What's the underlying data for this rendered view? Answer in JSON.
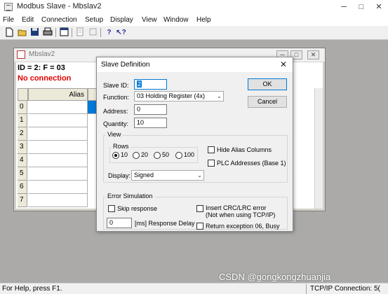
{
  "app": {
    "title": "Modbus Slave - Mbslav2",
    "controls": {
      "minimize": "─",
      "maximize": "□",
      "close": "✕"
    }
  },
  "menu": [
    "File",
    "Edit",
    "Connection",
    "Setup",
    "Display",
    "View",
    "Window",
    "Help"
  ],
  "toolbar": {
    "icons": [
      "new-icon",
      "open-icon",
      "save-icon",
      "print-icon",
      "window-icon",
      "read-definition-icon",
      "print-preview-icon",
      "help-icon",
      "context-help-icon"
    ]
  },
  "child": {
    "title": "Mbslav2",
    "info_line": "ID = 2: F = 03",
    "connection_status": "No connection",
    "column_header": "Alias",
    "rows": [
      "0",
      "1",
      "2",
      "3",
      "4",
      "5",
      "6",
      "7"
    ]
  },
  "dialog": {
    "title": "Slave Definition",
    "close": "✕",
    "slave_id_label": "Slave ID:",
    "slave_id_value": "2",
    "function_label": "Function:",
    "function_value": "03 Holding Register (4x)",
    "address_label": "Address:",
    "address_value": "0",
    "quantity_label": "Quantity:",
    "quantity_value": "10",
    "ok_label": "OK",
    "cancel_label": "Cancel",
    "view": {
      "group_label": "View",
      "rows_label": "Rows",
      "rows_options": [
        "10",
        "20",
        "50",
        "100"
      ],
      "rows_selected": "10",
      "hide_alias_label": "Hide Alias Columns",
      "plc_addresses_label": "PLC Addresses (Base 1)",
      "display_label": "Display:",
      "display_value": "Signed"
    },
    "error_sim": {
      "group_label": "Error Simulation",
      "skip_response_label": "Skip response",
      "insert_crc_label": "Insert CRC/LRC error",
      "insert_crc_note": "(Not when using TCP/IP)",
      "delay_value": "0",
      "delay_label": "[ms] Response Delay",
      "return_exception_label": "Return exception 06, Busy"
    }
  },
  "status": {
    "left": "For Help, press F1.",
    "right": "TCP/IP Connection: 5("
  },
  "watermark": "CSDN @gongkongzhuanjia"
}
